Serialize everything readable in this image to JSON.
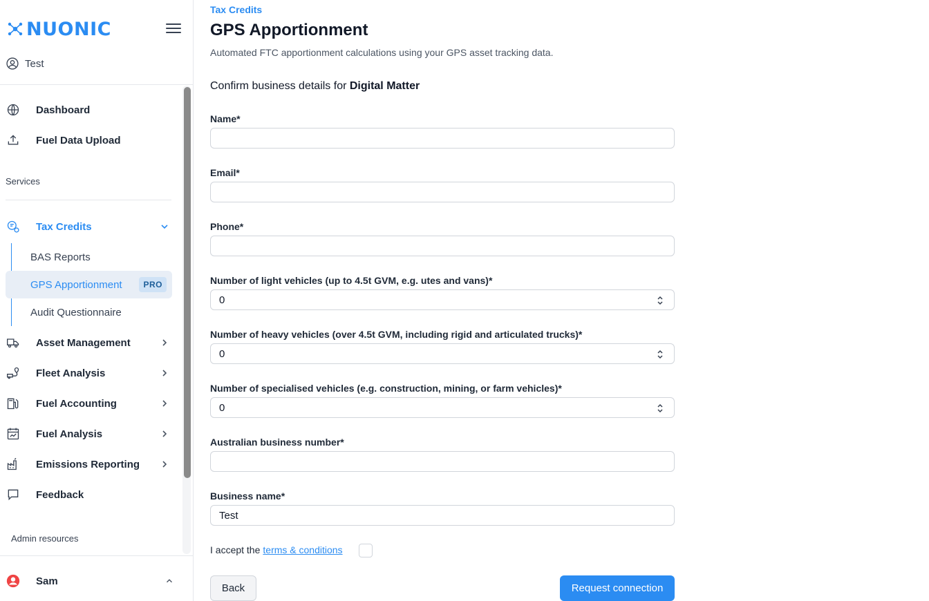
{
  "brand": {
    "name": "NUONIC",
    "accent": "#2b8cf2"
  },
  "org": {
    "name": "Test"
  },
  "nav": {
    "dashboard": "Dashboard",
    "fuel_upload": "Fuel Data Upload",
    "services_label": "Services",
    "tax_credits": "Tax Credits",
    "sub": {
      "bas": "BAS Reports",
      "gps": "GPS Apportionment",
      "pro_badge": "PRO",
      "audit": "Audit Questionnaire"
    },
    "asset_management": "Asset Management",
    "fleet_analysis": "Fleet Analysis",
    "fuel_accounting": "Fuel Accounting",
    "fuel_analysis": "Fuel Analysis",
    "emissions": "Emissions Reporting",
    "feedback": "Feedback",
    "admin_label": "Admin resources"
  },
  "user": {
    "name": "Sam"
  },
  "page": {
    "breadcrumb": "Tax Credits",
    "title": "GPS Apportionment",
    "subtitle": "Automated FTC apportionment calculations using your GPS asset tracking data.",
    "confirm_prefix": "Confirm business details for ",
    "company": "Digital Matter"
  },
  "form": {
    "name_label": "Name*",
    "name_value": "",
    "email_label": "Email*",
    "email_value": "",
    "phone_label": "Phone*",
    "phone_value": "",
    "light_label": "Number of light vehicles (up to 4.5t GVM, e.g. utes and vans)*",
    "light_value": "0",
    "heavy_label": "Number of heavy vehicles (over 4.5t GVM, including rigid and articulated trucks)*",
    "heavy_value": "0",
    "special_label": "Number of specialised vehicles (e.g. construction, mining, or farm vehicles)*",
    "special_value": "0",
    "abn_label": "Australian business number*",
    "abn_value": "",
    "bizname_label": "Business name*",
    "bizname_value": "Test",
    "terms_prefix": "I accept the",
    "terms_link": "terms & conditions",
    "back": "Back",
    "submit": "Request connection"
  }
}
